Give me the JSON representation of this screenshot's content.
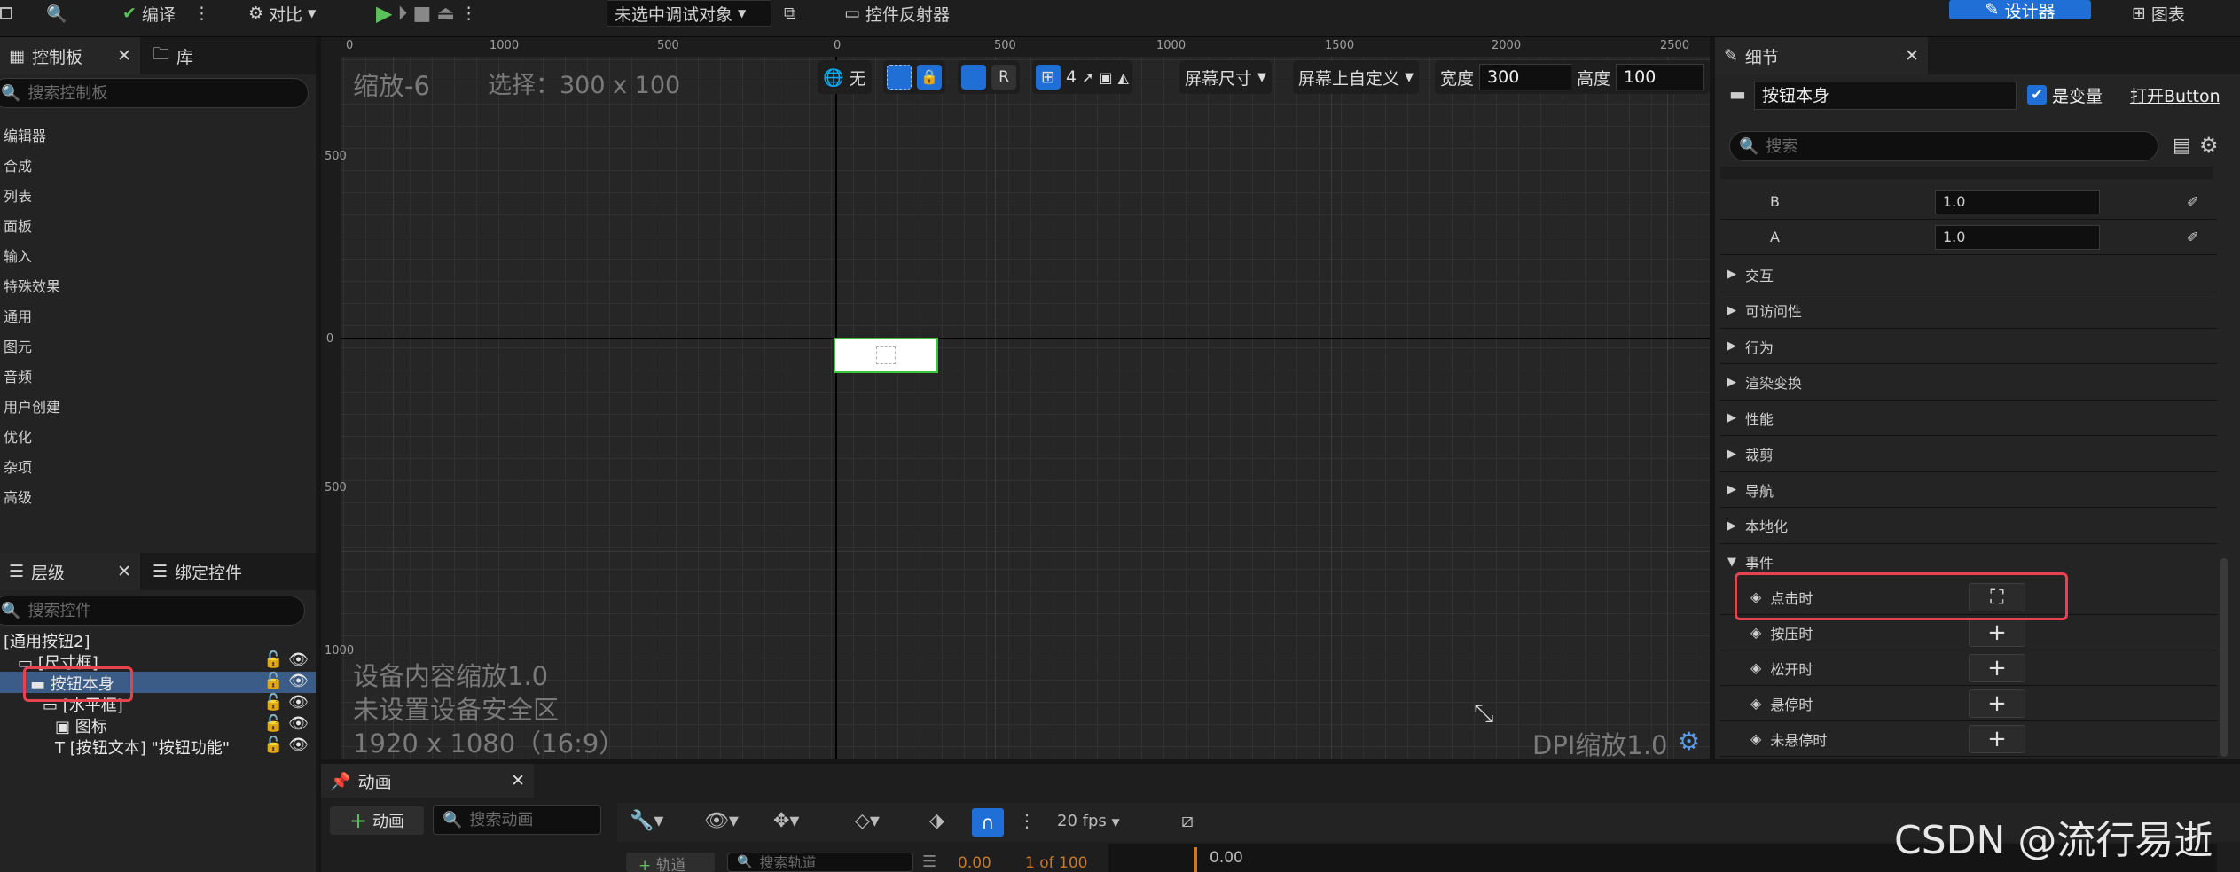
{
  "toolbar": {
    "compile_label": "编译",
    "compare_label": "对比",
    "debug_object": "未选中调试对象",
    "reflector_label": "控件反射器",
    "designer_label": "设计器",
    "graph_label": "图表"
  },
  "palette": {
    "tab_label": "控制板",
    "library_label": "库",
    "search_placeholder": "搜索控制板",
    "items": [
      "编辑器",
      "合成",
      "列表",
      "面板",
      "输入",
      "特殊效果",
      "通用",
      "图元",
      "音频",
      "用户创建",
      "优化",
      "杂项",
      "高级"
    ]
  },
  "hierarchy": {
    "tab_label": "层级",
    "bind_label": "绑定控件",
    "search_placeholder": "搜索控件",
    "root": "[通用按钮2]",
    "items": [
      "[尺寸框]",
      "按钮本身",
      "[水平框]",
      "图标",
      "[按钮文本] \"按钮功能\""
    ]
  },
  "canvas": {
    "zoom_label": "缩放-6",
    "selection_label": "选择：300 x 100",
    "none_label": "无",
    "grid_num": "4",
    "r_label": "R",
    "screen_size_label": "屏幕尺寸",
    "custom_label": "屏幕上自定义",
    "width_label": "宽度",
    "width_value": "300",
    "height_label": "高度",
    "height_value": "100",
    "ruler_top": [
      "0",
      "1000",
      "500",
      "0",
      "500",
      "1000",
      "1500",
      "2000",
      "2500"
    ],
    "ruler_left": [
      "500",
      "0",
      "500",
      "1000"
    ],
    "device_scale": "设备内容缩放1.0",
    "safe_zone": "未设置设备安全区",
    "resolution": "1920 x 1080（16:9）",
    "dpi_scale": "DPI缩放1.0"
  },
  "details": {
    "tab_label": "细节",
    "name_value": "按钮本身",
    "is_variable_label": "是变量",
    "open_label": "打开Button",
    "search_placeholder": "搜索",
    "color_b_label": "B",
    "color_b_value": "1.0",
    "color_a_label": "A",
    "color_a_value": "1.0",
    "sections": [
      "交互",
      "可访问性",
      "行为",
      "渲染变换",
      "性能",
      "裁剪",
      "导航",
      "本地化"
    ],
    "events_label": "事件",
    "events": [
      "点击时",
      "按压时",
      "松开时",
      "悬停时",
      "未悬停时"
    ]
  },
  "animation": {
    "tab_label": "动画",
    "add_label": "动画",
    "search_placeholder": "搜索动画",
    "fps_label": "20 fps",
    "track_label": "轨道",
    "track_search_placeholder": "搜索轨道",
    "time_value": "0.00",
    "frame_label": "1 of 100",
    "time_right": "0.00"
  },
  "watermark": "CSDN @流行易逝",
  "colors": {
    "accent_blue": "#1f6fd6",
    "highlight_red": "#e8424f",
    "selection_green": "#3fc43f"
  }
}
